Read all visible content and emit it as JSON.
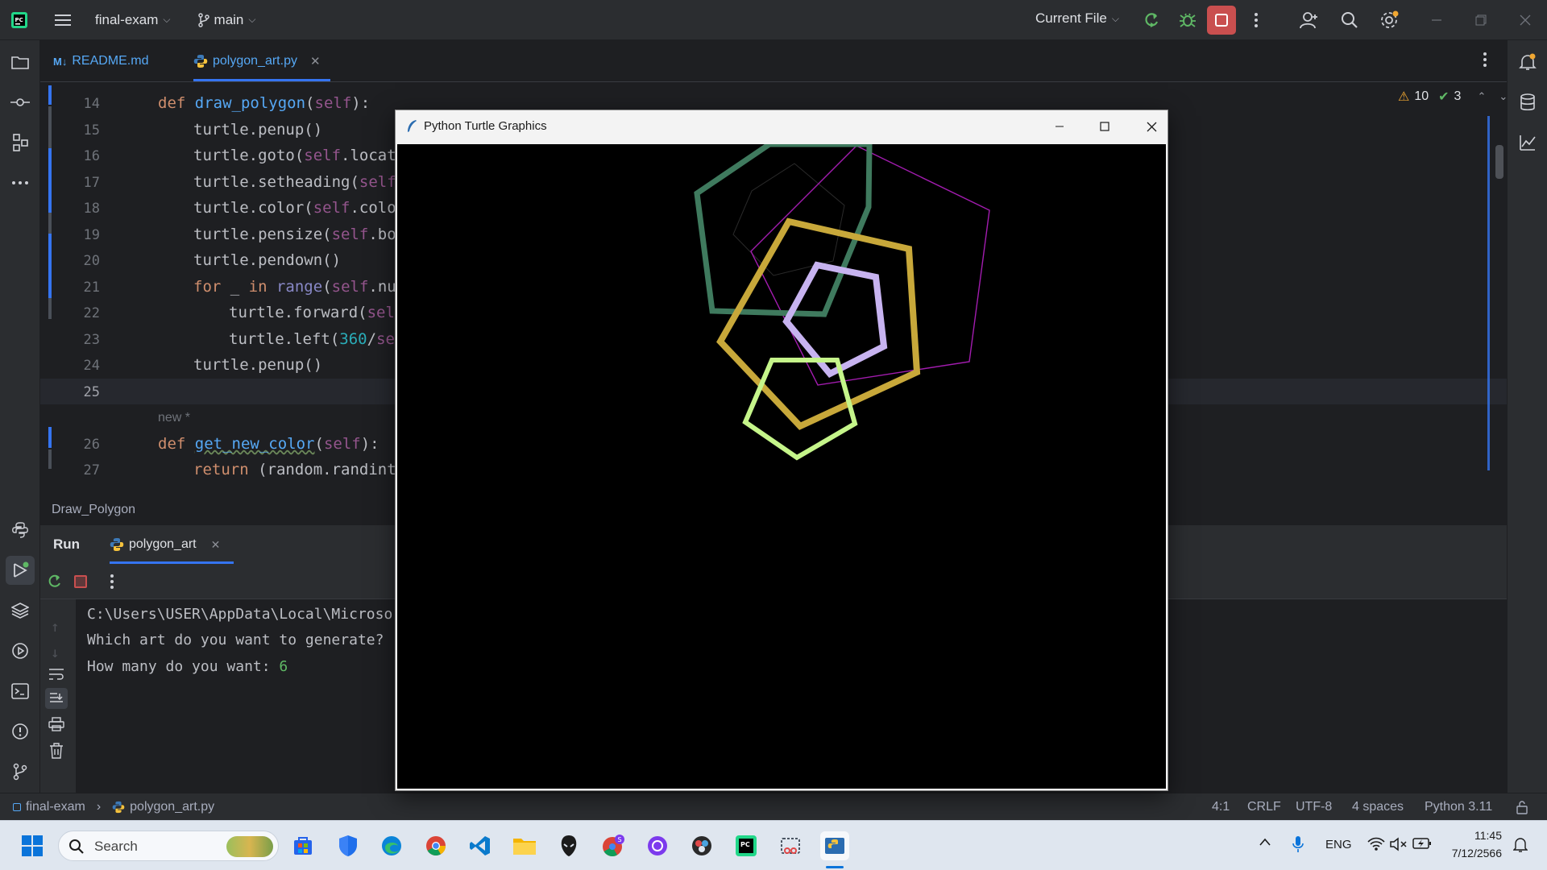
{
  "titlebar": {
    "project": "final-exam",
    "branch": "main",
    "run_config": "Current File"
  },
  "editor": {
    "tabs": [
      {
        "label": "README.md",
        "badge": "M↓"
      },
      {
        "label": "polygon_art.py"
      }
    ],
    "inspections": {
      "warnings": "10",
      "ok": "3"
    },
    "line_numbers": [
      "14",
      "15",
      "16",
      "17",
      "18",
      "19",
      "20",
      "21",
      "22",
      "23",
      "24",
      "25",
      "26",
      "27"
    ],
    "hint_label": "new *",
    "breadcrumb": "Draw_Polygon"
  },
  "run": {
    "tab_run": "Run",
    "tab_config": "polygon_art",
    "console": [
      "C:\\Users\\USER\\AppData\\Local\\Microso",
      "Which art do you want to generate?",
      "How many do you want: "
    ],
    "console_input": "6"
  },
  "statusbar": {
    "project": "final-exam",
    "file": "polygon_art.py",
    "position": "4:1",
    "line_sep": "CRLF",
    "encoding": "UTF-8",
    "indent": "4 spaces",
    "interpreter": "Python 3.11"
  },
  "turtle_window": {
    "title": "Python Turtle Graphics"
  },
  "taskbar": {
    "search_placeholder": "Search",
    "lang": "ENG",
    "time": "11:45",
    "date": "7/12/2566"
  },
  "colors": {
    "accent": "#3574f0",
    "stop_button": "#c94f4f",
    "green_run": "#5fb865"
  }
}
